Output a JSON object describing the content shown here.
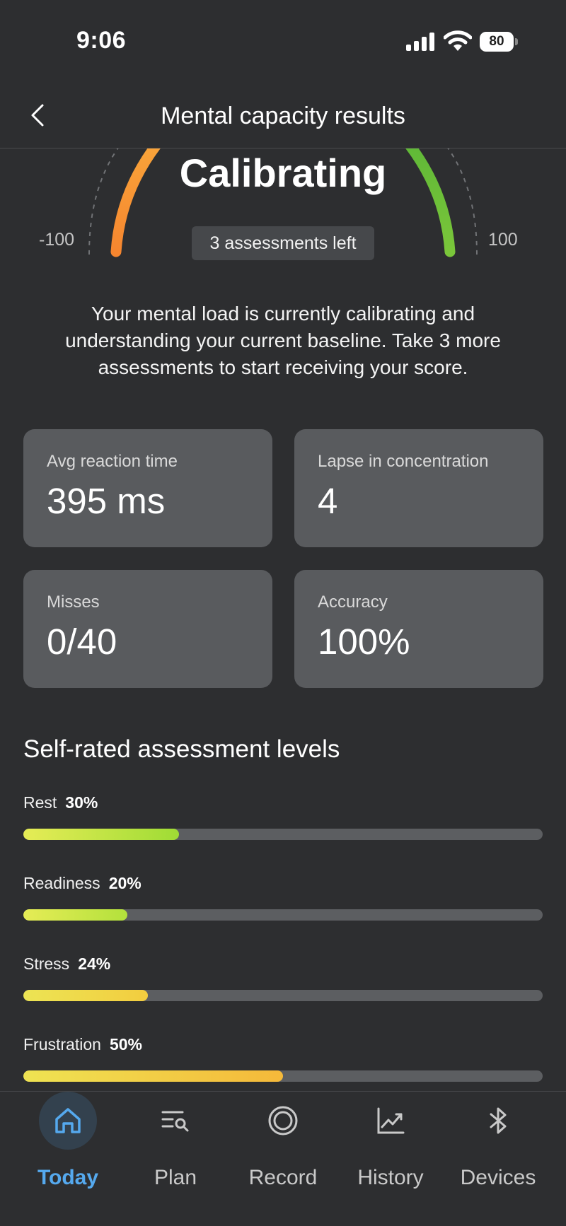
{
  "status_bar": {
    "time": "9:06",
    "battery": "80"
  },
  "header": {
    "title": "Mental capacity results"
  },
  "gauge": {
    "status": "Calibrating",
    "badge": "3 assessments left",
    "min_label": "-100",
    "max_label": "100",
    "colors": {
      "left": "#f6862f",
      "right": "#7ac63a"
    }
  },
  "description": "Your mental load is currently calibrating and understanding your current baseline. Take 3 more assessments to start receiving your score.",
  "metrics": [
    {
      "label": "Avg reaction time",
      "value": "395 ms"
    },
    {
      "label": "Lapse in concentration",
      "value": "4"
    },
    {
      "label": "Misses",
      "value": "0/40"
    },
    {
      "label": "Accuracy",
      "value": "100%"
    }
  ],
  "levels_section": {
    "title": "Self-rated assessment levels",
    "items": [
      {
        "label": "Rest",
        "percent_text": "30%",
        "value": 0.3,
        "gradient": [
          "#e6ec56",
          "#9fdc35"
        ]
      },
      {
        "label": "Readiness",
        "percent_text": "20%",
        "value": 0.2,
        "gradient": [
          "#e6ec56",
          "#b3e13c"
        ]
      },
      {
        "label": "Stress",
        "percent_text": "24%",
        "value": 0.24,
        "gradient": [
          "#ece454",
          "#f3cd3f"
        ]
      },
      {
        "label": "Frustration",
        "percent_text": "50%",
        "value": 0.5,
        "gradient": [
          "#efe352",
          "#f5b93a"
        ]
      }
    ]
  },
  "tabs": [
    {
      "label": "Today",
      "icon": "home-icon",
      "active": true
    },
    {
      "label": "Plan",
      "icon": "plan-search-icon",
      "active": false
    },
    {
      "label": "Record",
      "icon": "record-icon",
      "active": false
    },
    {
      "label": "History",
      "icon": "history-chart-icon",
      "active": false
    },
    {
      "label": "Devices",
      "icon": "bluetooth-icon",
      "active": false
    }
  ],
  "accent_color": "#55a9ee"
}
